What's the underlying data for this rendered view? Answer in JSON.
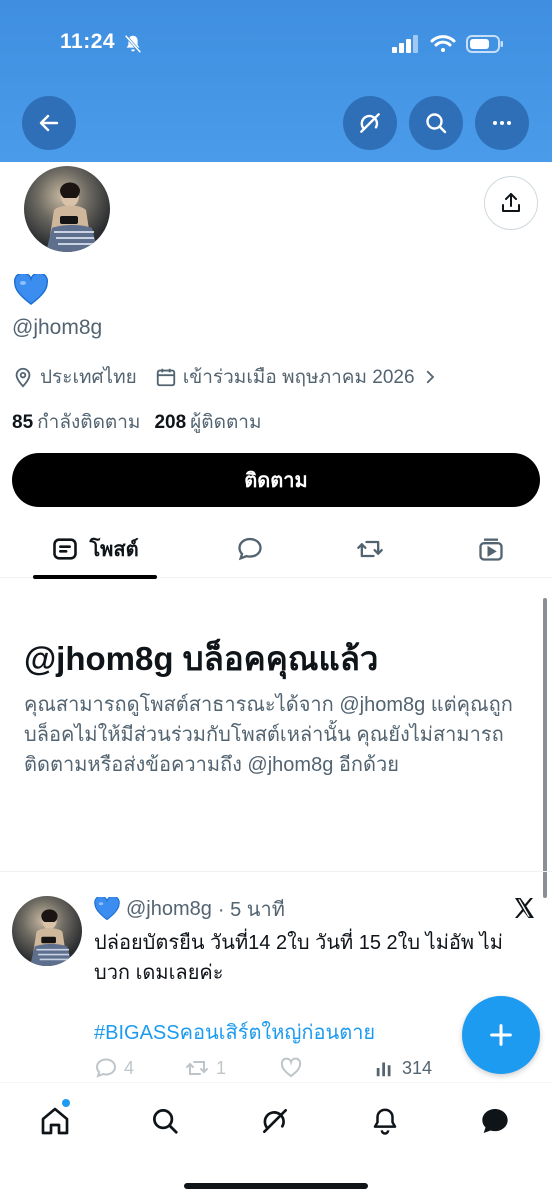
{
  "status_bar": {
    "time": "11:24"
  },
  "profile": {
    "bio_emoji": "💙",
    "handle": "@jhom8g",
    "location": "ประเทศไทย",
    "joined": "เข้าร่วมเมือ พฤษภาคม 2026",
    "following_count": "85",
    "following_label": "กำลังติดตาม",
    "followers_count": "208",
    "followers_label": "ผู้ติดตาม",
    "follow_button": "ติดตาม"
  },
  "tabs": {
    "posts_label": "โพสต์"
  },
  "blocked": {
    "title": "@jhom8g บล็อคคุณแล้ว",
    "description": "คุณสามารถดูโพสต์สาธารณะได้จาก @jhom8g แต่คุณถูกบล็อคไม่ให้มีส่วนร่วมกับโพสต์เหล่านั้น คุณยังไม่สามารถติดตามหรือส่งข้อความถึง @jhom8g อีกด้วย"
  },
  "tweet": {
    "author_emoji": "💙",
    "handle": "@jhom8g",
    "time": "· 5 นาที",
    "text": "ปล่อยบัตรยืน วันที่14 2ใบ วันที่ 15 2ใบ ไม่อัพ ไม่บวก เดมเลยค่ะ",
    "hashtag": "#BIGASSคอนเสิร์ตใหญ่ก่อนตาย",
    "reply_count": "4",
    "retweet_count": "1",
    "views_count": "314"
  },
  "colors": {
    "header": "#4a9cea",
    "accent": "#1d9bf0",
    "text": "#0f1419",
    "muted": "#536471"
  }
}
